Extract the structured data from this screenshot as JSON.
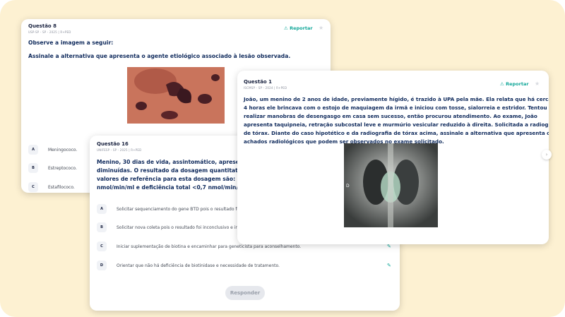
{
  "q8": {
    "title": "Questão 8",
    "source": "USP-SP - SP - 2025 | R+PED",
    "report": "Reportar",
    "stem": [
      "Observe a imagem a seguir:",
      "Assinale a alternativa que apresenta o agente etiológico associado à lesão observada."
    ],
    "options": [
      {
        "letter": "A",
        "text": "Meningococo."
      },
      {
        "letter": "B",
        "text": "Estreptococo."
      },
      {
        "letter": "C",
        "text": "Estafilococo."
      }
    ]
  },
  "q16": {
    "title": "Questão 16",
    "source": "UNIFESP - SP - 2025 | R+PED",
    "stem": [
      "Menino, 30 dias de vida, assintomático, apresenta du",
      "diminuídas. O resultado da dosagem quantitativa da",
      "valores de referência para esta dosagem são: normal",
      "nmol/min/ml e deficiência total <0,7 nmol/min/ml. Qu"
    ],
    "options": [
      {
        "letter": "A",
        "text": "Solicitar sequenciamento do gene BTD pois o resultado foi incon"
      },
      {
        "letter": "B",
        "text": "Solicitar nova coleta pois o resultado foi inconclusivo e iniciar sup"
      },
      {
        "letter": "C",
        "text": "Iniciar suplementação de biotina e encaminhar para geneticista para aconselhamento."
      },
      {
        "letter": "D",
        "text": "Orientar que não há deficiência de biotinidase e necessidade de tratamento."
      }
    ],
    "submit": "Responder"
  },
  "q1": {
    "title": "Questão 1",
    "source": "ISCMSP - SP - 2024 | R+PED",
    "report": "Reportar",
    "stem": [
      "João, um menino de 2 anos de idade, previamente hígido, é trazido à UPA pela mãe. Ela relata que há cerca de",
      "4 horas ele brincava com o estojo de maquiagem da irmã e iniciou com tosse, sialorreia e estridor. Tentou",
      "realizar manobras de desengasgo em casa sem sucesso, então procurou atendimento. Ao exame, João",
      "apresenta taquipneia, retração subcostal leve e murmúrio vesicular reduzido à direita. Solicitada a radiografia",
      "de tórax. Diante do caso hipotético e da radiografia de tórax acima, assinale a alternativa que apresenta os",
      "achados radiológicos que podem ser observados no exame solicitado."
    ],
    "xray_marker": "D"
  },
  "colors": {
    "accent": "#14a89a",
    "text": "#0f2a5c",
    "background": "#fdf1d2"
  }
}
